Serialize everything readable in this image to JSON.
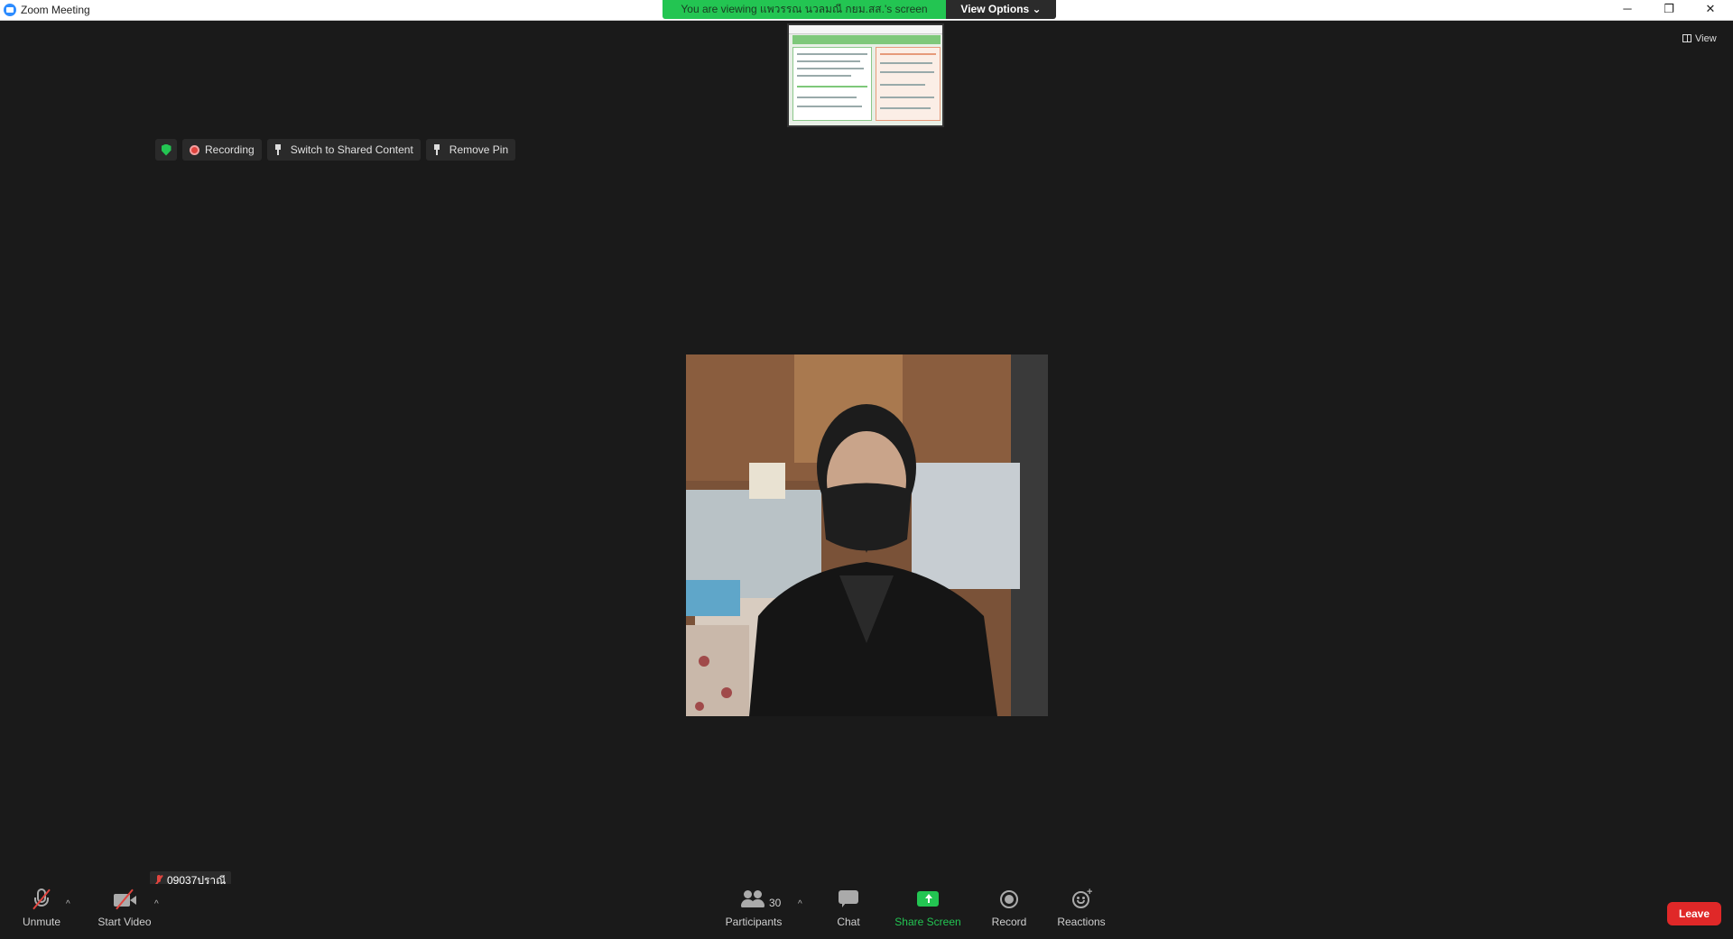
{
  "window": {
    "title": "Zoom Meeting",
    "minimize": "─",
    "maximize": "❐",
    "close": "✕"
  },
  "banner": {
    "viewing_text": "You are viewing แพวรรณ นวลมณี กยม.สส.'s screen",
    "view_options": "View Options ⌄"
  },
  "view_button": "View",
  "meeting_controls": {
    "recording": "Recording",
    "switch_shared": "Switch to Shared Content",
    "remove_pin": "Remove Pin"
  },
  "participant": {
    "name": "09037ปราณี"
  },
  "toolbar": {
    "unmute": "Unmute",
    "start_video": "Start Video",
    "participants": "Participants",
    "participant_count": "30",
    "chat": "Chat",
    "share_screen": "Share Screen",
    "record": "Record",
    "reactions": "Reactions",
    "leave": "Leave",
    "caret": "^"
  },
  "colors": {
    "accent_green": "#23c552",
    "leave_red": "#e02828",
    "background": "#1a1a1a"
  }
}
